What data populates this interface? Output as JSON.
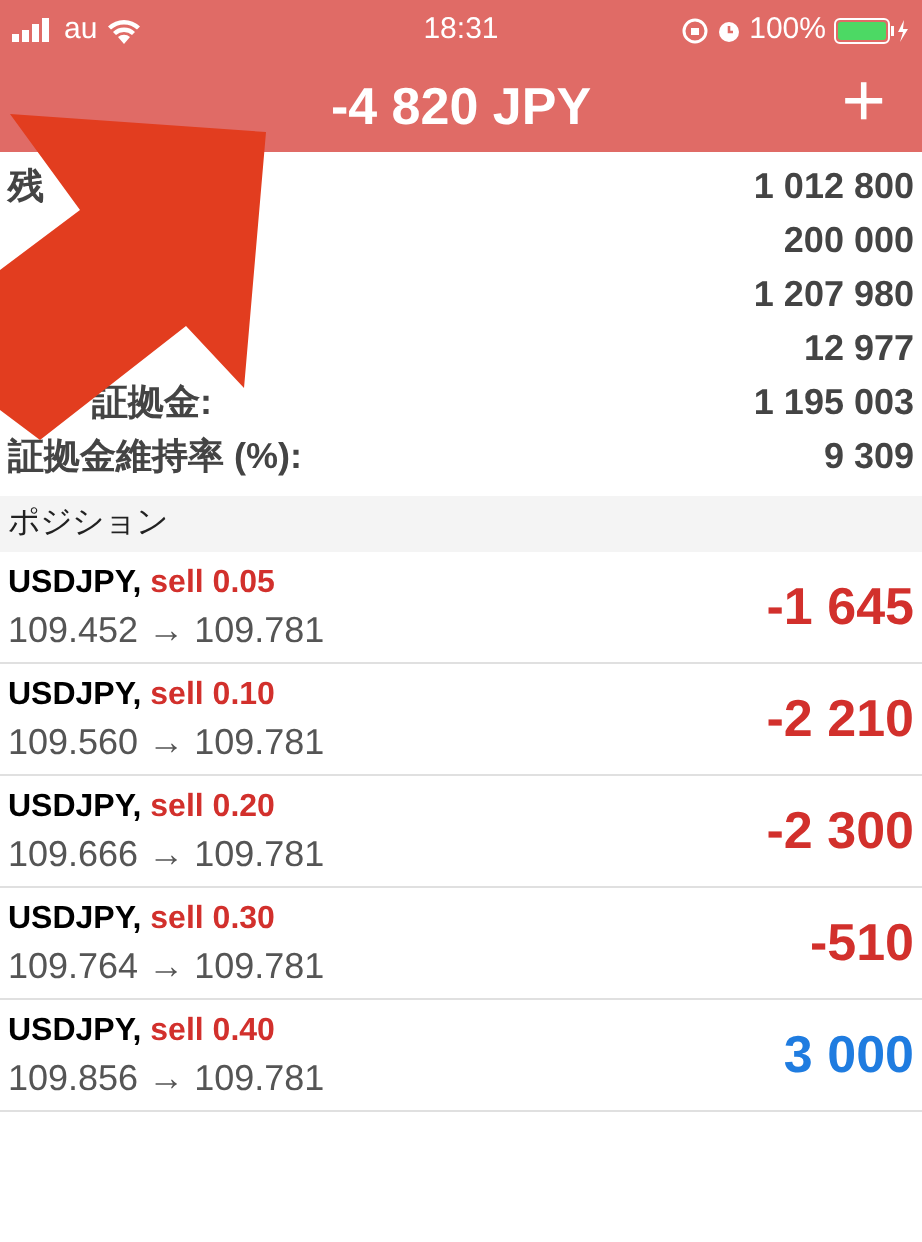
{
  "status_bar": {
    "carrier": "au",
    "time": "18:31",
    "battery": "100%"
  },
  "header": {
    "title": "-4 820 JPY",
    "add": "+"
  },
  "summary": [
    {
      "label": "残",
      "value": "1 012 800"
    },
    {
      "value": "200 000"
    },
    {
      "value": "1 207 980"
    },
    {
      "value": "12 977"
    },
    {
      "label": "証拠金:",
      "value": "1 195 003",
      "indent": true
    },
    {
      "label": "証拠金維持率 (%):",
      "value": "9 309"
    }
  ],
  "section": "ポジション",
  "positions": [
    {
      "symbol": "USDJPY,",
      "side": "sell 0.05",
      "prices": "109.452 → 109.781",
      "profit": "-1 645",
      "loss": true
    },
    {
      "symbol": "USDJPY,",
      "side": "sell 0.10",
      "prices": "109.560 → 109.781",
      "profit": "-2 210",
      "loss": true
    },
    {
      "symbol": "USDJPY,",
      "side": "sell 0.20",
      "prices": "109.666 → 109.781",
      "profit": "-2 300",
      "loss": true
    },
    {
      "symbol": "USDJPY,",
      "side": "sell 0.30",
      "prices": "109.764 → 109.781",
      "profit": "-510",
      "loss": true
    },
    {
      "symbol": "USDJPY,",
      "side": "sell 0.40",
      "prices": "109.856 → 109.781",
      "profit": "3 000",
      "loss": false
    }
  ]
}
